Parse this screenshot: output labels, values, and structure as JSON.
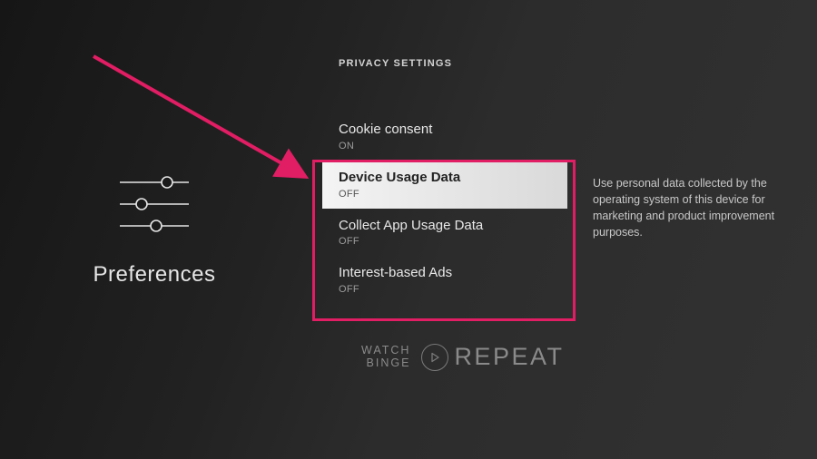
{
  "left_panel": {
    "title": "Preferences",
    "icon_name": "sliders-icon"
  },
  "section_heading": "PRIVACY SETTINGS",
  "items": [
    {
      "label": "Cookie consent",
      "value": "ON",
      "selected": false
    },
    {
      "label": "Device Usage Data",
      "value": "OFF",
      "selected": true
    },
    {
      "label": "Collect App Usage Data",
      "value": "OFF",
      "selected": false
    },
    {
      "label": "Interest-based Ads",
      "value": "OFF",
      "selected": false
    }
  ],
  "description": "Use personal data collected by the operating system of this device for marketing and product improvement purposes.",
  "annotation": {
    "arrow_color": "#e11d63",
    "highlight_color": "#e11d63"
  },
  "watermark": {
    "line1": "WATCH",
    "line2": "BINGE",
    "right": "REPEAT"
  }
}
